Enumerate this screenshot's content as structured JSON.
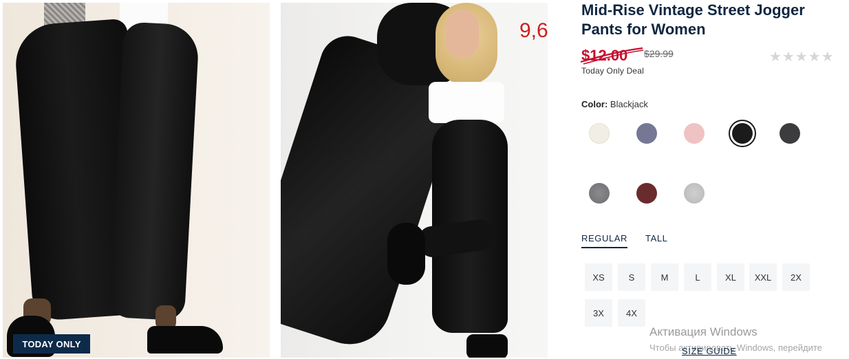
{
  "photos": {
    "badge_label": "TODAY ONLY"
  },
  "annotation": "9,6",
  "product": {
    "title": "Mid-Rise Vintage Street Jogger Pants for Women",
    "sale_price": "$12.00",
    "original_price": "$29.99",
    "deal_label": "Today Only Deal",
    "rating_stars": "★★★★★",
    "color_label": "Color:",
    "color_value": "Blackjack",
    "swatches": [
      {
        "name": "cream",
        "color": "#f1efe5"
      },
      {
        "name": "slate-blue",
        "color": "#747894"
      },
      {
        "name": "pink",
        "color": "#efc2c3"
      },
      {
        "name": "blackjack",
        "color": "#1b1b1b",
        "selected": true
      },
      {
        "name": "charcoal",
        "color": "#3c3b3d"
      },
      {
        "name": "heather-grey",
        "color": "#7d7d7f"
      },
      {
        "name": "burgundy",
        "color": "#6a2b2e"
      },
      {
        "name": "light-grey",
        "color": "#c3c3c3"
      }
    ],
    "fit_tabs": [
      "REGULAR",
      "TALL"
    ],
    "sizes": [
      "XS",
      "S",
      "M",
      "L",
      "XL",
      "XXL",
      "2X",
      "3X",
      "4X"
    ],
    "size_guide": "SIZE GUIDE"
  },
  "windows_watermark": {
    "line1": "Активация Windows",
    "line2": "Чтобы активировать Windows, перейдите"
  }
}
